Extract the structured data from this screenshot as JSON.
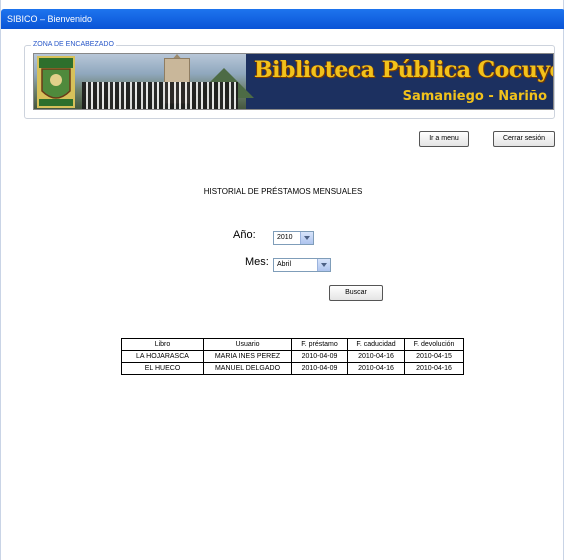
{
  "window": {
    "title": "SIBICO – Bienvenido"
  },
  "header_zone": {
    "legend": "ZONA DE ENCABEZADO",
    "banner_title": "Biblioteca Pública Cocuyos",
    "banner_subtitle": "Samaniego - Nariño"
  },
  "nav": {
    "menu_label": "Ir a menu",
    "logout_label": "Cerrar sesión"
  },
  "page": {
    "heading": "HISTORIAL DE PRÉSTAMOS MENSUALES"
  },
  "filters": {
    "year_label": "Año:",
    "year_value": "2010",
    "month_label": "Mes:",
    "month_value": "Abril",
    "search_label": "Buscar"
  },
  "table": {
    "columns": [
      "Libro",
      "Usuario",
      "F. préstamo",
      "F. caducidad",
      "F. devolución"
    ],
    "rows": [
      [
        "LA HOJARASCA",
        "MARIA INES PEREZ",
        "2010-04-09",
        "2010-04-16",
        "2010-04-15"
      ],
      [
        "EL HUECO",
        "MANUEL DELGADO",
        "2010-04-09",
        "2010-04-16",
        "2010-04-16"
      ]
    ]
  },
  "colors": {
    "titlebar": "#0a54d6",
    "legend": "#2857c8",
    "banner_text": "#f2c21b",
    "banner_bg": "#1c3060"
  }
}
